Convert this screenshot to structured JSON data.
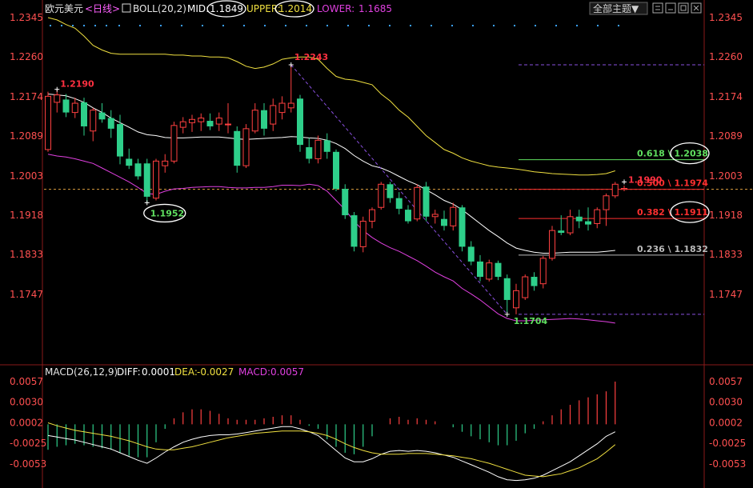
{
  "header": {
    "symbol": "欧元美元",
    "period": "<日线>",
    "indicator_name": "BOLL(20,2)",
    "mid_label": "MID:",
    "mid_value": "1.1849",
    "upper_label": "UPPER:",
    "upper_value": "1.2014",
    "lower_label": "LOWER:",
    "lower_value": "1.1685",
    "theme_button": "全部主题▼",
    "colors": {
      "mid": "#ffffff",
      "upper": "#f0e040",
      "lower": "#e040e0"
    }
  },
  "macd_header": {
    "name": "MACD(26,12,9)",
    "diff_label": "DIFF:",
    "diff_value": "0.0001",
    "dea_label": "DEA:",
    "dea_value": "-0.0027",
    "macd_label": "MACD:",
    "macd_value": "0.0057"
  },
  "chart_data": [
    {
      "type": "candlestick",
      "y_ticks": [
        "1.2345",
        "1.2260",
        "1.2174",
        "1.2089",
        "1.2003",
        "1.1918",
        "1.1833",
        "1.1747"
      ],
      "ylim": [
        1.169,
        1.2345
      ],
      "candles": [
        {
          "o": 1.206,
          "h": 1.2185,
          "l": 1.2055,
          "c": 1.2175
        },
        {
          "o": 1.2162,
          "h": 1.219,
          "l": 1.214,
          "c": 1.2178
        },
        {
          "o": 1.2168,
          "h": 1.218,
          "l": 1.213,
          "c": 1.214
        },
        {
          "o": 1.214,
          "h": 1.2172,
          "l": 1.2128,
          "c": 1.216
        },
        {
          "o": 1.2162,
          "h": 1.2172,
          "l": 1.209,
          "c": 1.211
        },
        {
          "o": 1.21,
          "h": 1.215,
          "l": 1.2078,
          "c": 1.2145
        },
        {
          "o": 1.214,
          "h": 1.216,
          "l": 1.2118,
          "c": 1.2125
        },
        {
          "o": 1.2128,
          "h": 1.2145,
          "l": 1.2085,
          "c": 1.2105
        },
        {
          "o": 1.2115,
          "h": 1.2135,
          "l": 1.2028,
          "c": 1.2045
        },
        {
          "o": 1.204,
          "h": 1.2062,
          "l": 1.2018,
          "c": 1.2025
        },
        {
          "o": 1.203,
          "h": 1.204,
          "l": 1.1995,
          "c": 1.2002
        },
        {
          "o": 1.203,
          "h": 1.204,
          "l": 1.1945,
          "c": 1.1958
        },
        {
          "o": 1.1955,
          "h": 1.204,
          "l": 1.195,
          "c": 1.2035
        },
        {
          "o": 1.2025,
          "h": 1.205,
          "l": 1.201,
          "c": 1.2035
        },
        {
          "o": 1.2035,
          "h": 1.212,
          "l": 1.203,
          "c": 1.2112
        },
        {
          "o": 1.2108,
          "h": 1.213,
          "l": 1.2095,
          "c": 1.212
        },
        {
          "o": 1.2118,
          "h": 1.2135,
          "l": 1.2098,
          "c": 1.2125
        },
        {
          "o": 1.212,
          "h": 1.2138,
          "l": 1.21,
          "c": 1.2128
        },
        {
          "o": 1.2122,
          "h": 1.2138,
          "l": 1.2102,
          "c": 1.211
        },
        {
          "o": 1.2115,
          "h": 1.214,
          "l": 1.21,
          "c": 1.2128
        },
        {
          "o": 1.2115,
          "h": 1.216,
          "l": 1.2095,
          "c": 1.2115
        },
        {
          "o": 1.21,
          "h": 1.211,
          "l": 1.201,
          "c": 1.2025
        },
        {
          "o": 1.2025,
          "h": 1.2115,
          "l": 1.202,
          "c": 1.2105
        },
        {
          "o": 1.21,
          "h": 1.216,
          "l": 1.2095,
          "c": 1.2145
        },
        {
          "o": 1.2145,
          "h": 1.216,
          "l": 1.209,
          "c": 1.2105
        },
        {
          "o": 1.2115,
          "h": 1.217,
          "l": 1.21,
          "c": 1.2155
        },
        {
          "o": 1.214,
          "h": 1.2175,
          "l": 1.2125,
          "c": 1.216
        },
        {
          "o": 1.215,
          "h": 1.2243,
          "l": 1.214,
          "c": 1.216
        },
        {
          "o": 1.217,
          "h": 1.2178,
          "l": 1.2055,
          "c": 1.207
        },
        {
          "o": 1.2065,
          "h": 1.2085,
          "l": 1.203,
          "c": 1.204
        },
        {
          "o": 1.204,
          "h": 1.209,
          "l": 1.203,
          "c": 1.208
        },
        {
          "o": 1.208,
          "h": 1.2095,
          "l": 1.204,
          "c": 1.2055
        },
        {
          "o": 1.2055,
          "h": 1.206,
          "l": 1.197,
          "c": 1.1975
        },
        {
          "o": 1.1975,
          "h": 1.1985,
          "l": 1.191,
          "c": 1.1918
        },
        {
          "o": 1.1918,
          "h": 1.1925,
          "l": 1.184,
          "c": 1.185
        },
        {
          "o": 1.185,
          "h": 1.1915,
          "l": 1.1838,
          "c": 1.1905
        },
        {
          "o": 1.1905,
          "h": 1.1935,
          "l": 1.189,
          "c": 1.193
        },
        {
          "o": 1.1935,
          "h": 1.199,
          "l": 1.193,
          "c": 1.1985
        },
        {
          "o": 1.1985,
          "h": 1.199,
          "l": 1.1945,
          "c": 1.1955
        },
        {
          "o": 1.1955,
          "h": 1.1968,
          "l": 1.192,
          "c": 1.1932
        },
        {
          "o": 1.193,
          "h": 1.194,
          "l": 1.19,
          "c": 1.1905
        },
        {
          "o": 1.191,
          "h": 1.1985,
          "l": 1.1905,
          "c": 1.1978
        },
        {
          "o": 1.198,
          "h": 1.199,
          "l": 1.1905,
          "c": 1.1915
        },
        {
          "o": 1.1915,
          "h": 1.193,
          "l": 1.19,
          "c": 1.192
        },
        {
          "o": 1.191,
          "h": 1.1928,
          "l": 1.1885,
          "c": 1.1895
        },
        {
          "o": 1.1895,
          "h": 1.1945,
          "l": 1.1885,
          "c": 1.1935
        },
        {
          "o": 1.1935,
          "h": 1.194,
          "l": 1.184,
          "c": 1.185
        },
        {
          "o": 1.185,
          "h": 1.1862,
          "l": 1.181,
          "c": 1.1818
        },
        {
          "o": 1.1818,
          "h": 1.1832,
          "l": 1.1775,
          "c": 1.1785
        },
        {
          "o": 1.178,
          "h": 1.1822,
          "l": 1.1775,
          "c": 1.1815
        },
        {
          "o": 1.1815,
          "h": 1.182,
          "l": 1.1778,
          "c": 1.1785
        },
        {
          "o": 1.1782,
          "h": 1.179,
          "l": 1.1708,
          "c": 1.1735
        },
        {
          "o": 1.1718,
          "h": 1.177,
          "l": 1.1704,
          "c": 1.1755
        },
        {
          "o": 1.174,
          "h": 1.179,
          "l": 1.1735,
          "c": 1.1785
        },
        {
          "o": 1.1785,
          "h": 1.1795,
          "l": 1.1755,
          "c": 1.1765
        },
        {
          "o": 1.177,
          "h": 1.183,
          "l": 1.176,
          "c": 1.1825
        },
        {
          "o": 1.1825,
          "h": 1.1895,
          "l": 1.182,
          "c": 1.1885
        },
        {
          "o": 1.1885,
          "h": 1.1918,
          "l": 1.1875,
          "c": 1.188
        },
        {
          "o": 1.188,
          "h": 1.193,
          "l": 1.1875,
          "c": 1.1915
        },
        {
          "o": 1.1915,
          "h": 1.193,
          "l": 1.189,
          "c": 1.1905
        },
        {
          "o": 1.1905,
          "h": 1.1935,
          "l": 1.1885,
          "c": 1.1898
        },
        {
          "o": 1.19,
          "h": 1.1935,
          "l": 1.189,
          "c": 1.193
        },
        {
          "o": 1.193,
          "h": 1.1965,
          "l": 1.1895,
          "c": 1.196
        },
        {
          "o": 1.196,
          "h": 1.199,
          "l": 1.1955,
          "c": 1.1985
        },
        {
          "o": 1.1974,
          "h": 1.1982,
          "l": 1.197,
          "c": 1.1976
        }
      ],
      "boll": {
        "mid": [
          1.218,
          1.2178,
          1.2176,
          1.217,
          1.2162,
          1.215,
          1.214,
          1.2128,
          1.2118,
          1.2108,
          1.2098,
          1.2092,
          1.209,
          1.2086,
          1.2085,
          1.2085,
          1.2086,
          1.2087,
          1.2087,
          1.2087,
          1.2085,
          1.2083,
          1.2082,
          1.2083,
          1.2084,
          1.2085,
          1.2086,
          1.2088,
          1.2087,
          1.2085,
          1.2084,
          1.208,
          1.2073,
          1.2062,
          1.2047,
          1.2035,
          1.2025,
          1.202,
          1.2012,
          1.2002,
          1.1992,
          1.1984,
          1.1973,
          1.1962,
          1.195,
          1.1942,
          1.193,
          1.1915,
          1.19,
          1.1885,
          1.1872,
          1.1858,
          1.1847,
          1.1842,
          1.1838,
          1.1836,
          1.1836,
          1.1837,
          1.1838,
          1.1838,
          1.1838,
          1.1838,
          1.184,
          1.1842
        ],
        "upper": [
          1.2345,
          1.234,
          1.233,
          1.2322,
          1.2305,
          1.2285,
          1.2275,
          1.2268,
          1.2266,
          1.2266,
          1.2266,
          1.2266,
          1.2266,
          1.2266,
          1.2264,
          1.2264,
          1.2262,
          1.2262,
          1.226,
          1.226,
          1.2258,
          1.225,
          1.224,
          1.2235,
          1.2238,
          1.2245,
          1.2255,
          1.2258,
          1.226,
          1.226,
          1.2255,
          1.2235,
          1.2218,
          1.2212,
          1.221,
          1.2205,
          1.22,
          1.218,
          1.2165,
          1.2145,
          1.213,
          1.211,
          1.209,
          1.2075,
          1.206,
          1.2052,
          1.2042,
          1.2035,
          1.203,
          1.2025,
          1.2022,
          1.202,
          1.2018,
          1.2015,
          1.2012,
          1.201,
          1.2008,
          1.2007,
          1.2006,
          1.2005,
          1.2005,
          1.2006,
          1.2008,
          1.2014
        ],
        "lower": [
          1.205,
          1.2046,
          1.2044,
          1.204,
          1.2035,
          1.203,
          1.202,
          1.201,
          1.2,
          1.199,
          1.1978,
          1.1965,
          1.1963,
          1.197,
          1.1975,
          1.1976,
          1.1978,
          1.1979,
          1.198,
          1.198,
          1.1978,
          1.1977,
          1.1977,
          1.1978,
          1.1978,
          1.198,
          1.1983,
          1.1983,
          1.1982,
          1.1985,
          1.1982,
          1.197,
          1.195,
          1.193,
          1.1905,
          1.1885,
          1.187,
          1.1858,
          1.1848,
          1.184,
          1.183,
          1.182,
          1.1808,
          1.1795,
          1.1785,
          1.1776,
          1.176,
          1.1748,
          1.1735,
          1.172,
          1.1705,
          1.1695,
          1.169,
          1.169,
          1.1691,
          1.1692,
          1.1693,
          1.1694,
          1.1695,
          1.1694,
          1.1692,
          1.169,
          1.1688,
          1.1685
        ]
      },
      "annotations": {
        "high_1": "1.2190",
        "high_2": "1.2243",
        "low_1": "1.1952",
        "low_2": "1.1704",
        "last": "1.1990"
      },
      "fibonacci": [
        {
          "label": "0.618 \\ 1.2038",
          "level": 1.2038
        },
        {
          "label": "0.500 \\ 1.1974",
          "level": 1.1974
        },
        {
          "label": "0.382 \\ 1.1911",
          "level": 1.1911
        },
        {
          "label": "0.236 \\ 1.1832",
          "level": 1.1832
        }
      ],
      "fib_top": 1.2243,
      "fib_bottom": 1.1704,
      "reference_level": 1.1974
    },
    {
      "type": "macd",
      "y_ticks": [
        "0.0057",
        "0.0030",
        "0.0002",
        "-0.0025",
        "-0.0053"
      ],
      "ylim": [
        -0.0075,
        0.0062
      ],
      "diff": [
        -0.0015,
        -0.0017,
        -0.0019,
        -0.0021,
        -0.0024,
        -0.0027,
        -0.003,
        -0.0033,
        -0.0038,
        -0.0043,
        -0.0048,
        -0.0052,
        -0.0045,
        -0.0037,
        -0.003,
        -0.0024,
        -0.002,
        -0.0017,
        -0.0015,
        -0.0014,
        -0.0014,
        -0.0013,
        -0.0011,
        -0.0009,
        -0.0007,
        -0.0005,
        -0.0003,
        -0.0003,
        -0.0006,
        -0.001,
        -0.0015,
        -0.0025,
        -0.0035,
        -0.0045,
        -0.005,
        -0.005,
        -0.0046,
        -0.004,
        -0.0036,
        -0.0035,
        -0.0036,
        -0.0035,
        -0.0036,
        -0.0038,
        -0.0041,
        -0.0044,
        -0.0049,
        -0.0054,
        -0.0059,
        -0.0064,
        -0.007,
        -0.0074,
        -0.0075,
        -0.0074,
        -0.0072,
        -0.0068,
        -0.0062,
        -0.0056,
        -0.005,
        -0.0042,
        -0.0034,
        -0.0026,
        -0.0016,
        -0.001
      ],
      "dea": [
        0.0002,
        -0.0002,
        -0.0005,
        -0.0008,
        -0.001,
        -0.0012,
        -0.0014,
        -0.0016,
        -0.0019,
        -0.0022,
        -0.0026,
        -0.003,
        -0.0033,
        -0.0034,
        -0.0034,
        -0.0032,
        -0.003,
        -0.0027,
        -0.0024,
        -0.0021,
        -0.0018,
        -0.0016,
        -0.0014,
        -0.0012,
        -0.0011,
        -0.001,
        -0.0009,
        -0.0009,
        -0.0009,
        -0.001,
        -0.0012,
        -0.0015,
        -0.002,
        -0.0026,
        -0.0031,
        -0.0035,
        -0.0038,
        -0.004,
        -0.004,
        -0.004,
        -0.0039,
        -0.0039,
        -0.0039,
        -0.004,
        -0.0041,
        -0.0042,
        -0.0044,
        -0.0046,
        -0.0049,
        -0.0052,
        -0.0056,
        -0.006,
        -0.0064,
        -0.0068,
        -0.0069,
        -0.007,
        -0.0068,
        -0.0066,
        -0.0062,
        -0.0058,
        -0.0052,
        -0.0046,
        -0.0037,
        -0.0027
      ],
      "macd": [
        -0.0034,
        -0.003,
        -0.0028,
        -0.0026,
        -0.0028,
        -0.003,
        -0.0032,
        -0.0034,
        -0.0038,
        -0.0042,
        -0.0044,
        -0.0044,
        -0.0024,
        -0.0006,
        0.0008,
        0.0016,
        0.002,
        0.002,
        0.0018,
        0.0014,
        0.0008,
        0.0006,
        0.0006,
        0.0006,
        0.0008,
        0.001,
        0.0012,
        0.0012,
        0.0006,
        -0.0002,
        -0.0006,
        -0.002,
        -0.003,
        -0.0038,
        -0.004,
        -0.003,
        -0.0016,
        0.0,
        0.0008,
        0.001,
        0.0006,
        0.0008,
        0.0006,
        0.0004,
        0.0,
        -0.0004,
        -0.001,
        -0.0016,
        -0.002,
        -0.0024,
        -0.0028,
        -0.0028,
        -0.0022,
        -0.0012,
        -0.0006,
        0.0004,
        0.0012,
        0.002,
        0.0026,
        0.0032,
        0.0036,
        0.004,
        0.0044,
        0.0057
      ]
    }
  ],
  "colors": {
    "background": "#000000",
    "up_candle": "#ff4040",
    "down_candle": "#2ecf8a",
    "axis_text": "#ff5050",
    "fib_green": "#60e060",
    "fib_red": "#ff3030",
    "fib_gray": "#bbbbbb",
    "purple_dash": "#8a50e0",
    "orange_dash": "#e0a040",
    "dots": "#3aa0ff"
  },
  "icons": {
    "tool_1": "settings-icon",
    "tool_2": "minimize-icon",
    "tool_3": "restore-icon",
    "tool_4": "close-icon"
  }
}
